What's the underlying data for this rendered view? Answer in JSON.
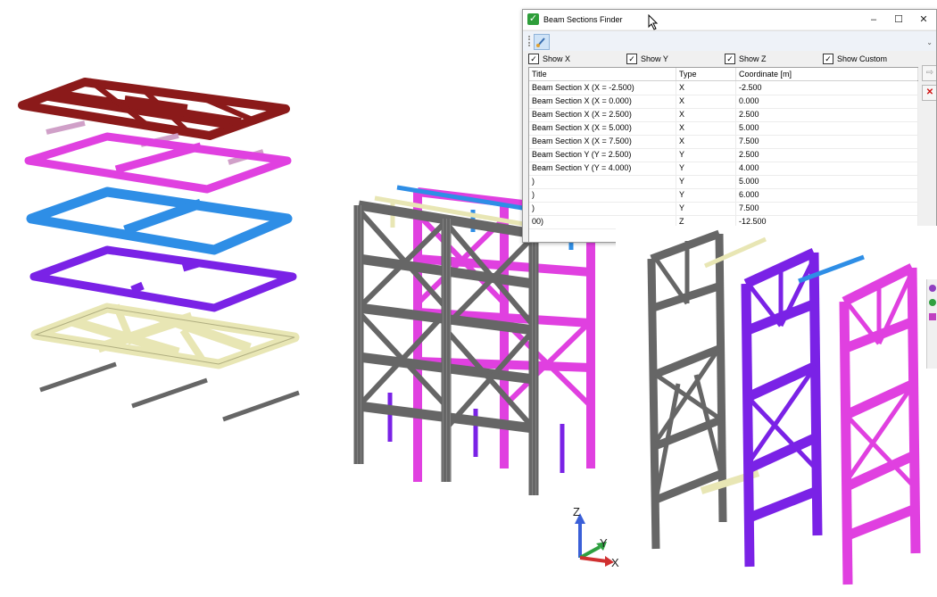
{
  "dialog": {
    "title": "Beam Sections Finder",
    "window_buttons": [
      "–",
      "☐",
      "✕"
    ],
    "toolbar_more": "⌄",
    "filters": [
      {
        "label": "Show X",
        "checked": true
      },
      {
        "label": "Show Y",
        "checked": true
      },
      {
        "label": "Show Z",
        "checked": true
      },
      {
        "label": "Show Custom",
        "checked": true
      }
    ],
    "columns": [
      "Title",
      "Type",
      "Coordinate [m]"
    ],
    "rows": [
      {
        "title": "Beam Section X (X = -2.500)",
        "type": "X",
        "coord": "-2.500"
      },
      {
        "title": "Beam Section X (X = 0.000)",
        "type": "X",
        "coord": "0.000"
      },
      {
        "title": "Beam Section X (X = 2.500)",
        "type": "X",
        "coord": "2.500"
      },
      {
        "title": "Beam Section X (X = 5.000)",
        "type": "X",
        "coord": "5.000"
      },
      {
        "title": "Beam Section X (X = 7.500)",
        "type": "X",
        "coord": "7.500"
      },
      {
        "title": "Beam Section Y (Y = 2.500)",
        "type": "Y",
        "coord": "2.500"
      },
      {
        "title": "Beam Section Y (Y = 4.000)",
        "type": "Y",
        "coord": "4.000"
      },
      {
        "title": ")",
        "type": "Y",
        "coord": "5.000"
      },
      {
        "title": ")",
        "type": "Y",
        "coord": "6.000"
      },
      {
        "title": ")",
        "type": "Y",
        "coord": "7.500"
      },
      {
        "title": "00)",
        "type": "Z",
        "coord": "-12.500"
      }
    ],
    "side_buttons": {
      "add": "⇨",
      "delete": "✕"
    }
  },
  "triad": {
    "z": "Z",
    "y": "Y",
    "x": "X"
  },
  "colors": {
    "darkred": "#8b1a1a",
    "magenta": "#e040e0",
    "blue": "#2e8ee6",
    "purple": "#7a22e6",
    "cream": "#e8e6b4",
    "gray": "#666666",
    "accent_green": "#2e9e3a"
  }
}
